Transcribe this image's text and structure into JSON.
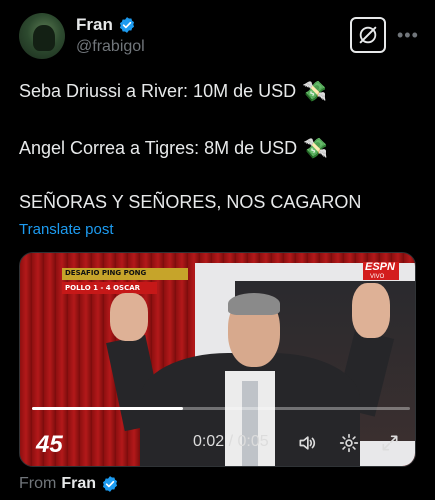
{
  "author": {
    "name": "Fran",
    "handle": "@frabigol"
  },
  "tweet": {
    "lines": [
      {
        "text": "Seba Driussi a River: 10M de USD",
        "emoji": "💸"
      },
      {
        "text": "Angel Correa a Tigres: 8M de USD",
        "emoji": "💸"
      },
      {
        "text": "SEÑORAS Y SEÑORES, NOS CAGARON"
      }
    ],
    "translate_label": "Translate post"
  },
  "video": {
    "graphic_title": "DESAFIO PING PONG",
    "graphic_score": "POLLO 1 - 4 OSCAR",
    "channel": "ESPN",
    "live_label": "VIVO",
    "program_logo": "45",
    "time_display": "0:02 / 0:05",
    "progress": 0.4
  },
  "footer": {
    "from_label": "From",
    "from_name": "Fran"
  },
  "colors": {
    "link": "#1d9bf0",
    "verified": "#1d9bf0",
    "muted": "#71767b",
    "text": "#e7e9ea"
  },
  "icons": [
    "verified-badge-icon",
    "grok-icon",
    "more-icon",
    "volume-icon",
    "settings-icon",
    "fullscreen-icon"
  ]
}
